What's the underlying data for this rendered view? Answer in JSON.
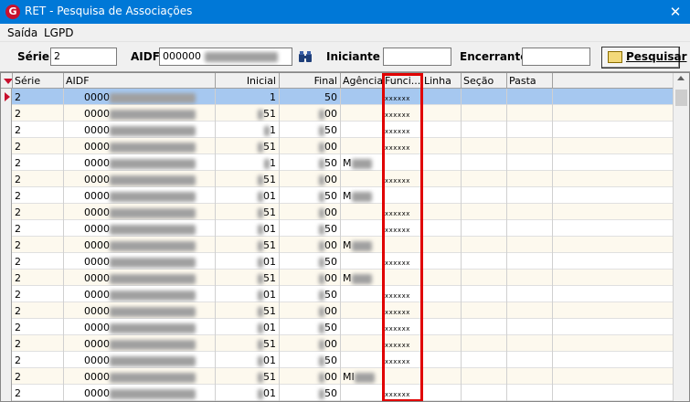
{
  "window": {
    "app_icon": "G",
    "title": "RET - Pesquisa de Associações",
    "close_label": "✕"
  },
  "menu": {
    "items": [
      "Saída",
      "LGPD"
    ]
  },
  "toolbar": {
    "serie_label": "Série",
    "serie_value": "2",
    "aidf_label": "AIDF",
    "aidf_value": "000000",
    "aidf_lookup_icon": "binoculars-icon",
    "iniciante_label": "Iniciante",
    "iniciante_value": "",
    "encerrante_label": "Encerrante",
    "encerrante_value": "",
    "search_button_label": "Pesquisar",
    "search_button_icon": "search-icon"
  },
  "grid": {
    "columns": [
      "Série",
      "AIDF",
      "Inicial",
      "Final",
      "Agência",
      "Funci...",
      "Linha",
      "Seção",
      "Pasta"
    ],
    "highlight_color": "#e00000",
    "selected_row_color": "#a6c8f0",
    "rows": [
      {
        "serie": "2",
        "aidf": "0000",
        "inicial": "1",
        "final": "50",
        "agencia": "",
        "funci": "xxxxxx"
      },
      {
        "serie": "2",
        "aidf": "0000",
        "inicial": "51",
        "final": "00",
        "agencia": "",
        "funci": "xxxxxx"
      },
      {
        "serie": "2",
        "aidf": "0000",
        "inicial": "1",
        "final": "50",
        "agencia": "",
        "funci": "xxxxxx"
      },
      {
        "serie": "2",
        "aidf": "0000",
        "inicial": "51",
        "final": "00",
        "agencia": "",
        "funci": "xxxxxx"
      },
      {
        "serie": "2",
        "aidf": "0000",
        "inicial": "1",
        "final": "50",
        "agencia": "M",
        "funci": ""
      },
      {
        "serie": "2",
        "aidf": "0000",
        "inicial": "51",
        "final": "00",
        "agencia": "",
        "funci": "xxxxxx"
      },
      {
        "serie": "2",
        "aidf": "0000",
        "inicial": "01",
        "final": "50",
        "agencia": "M",
        "funci": ""
      },
      {
        "serie": "2",
        "aidf": "0000",
        "inicial": "51",
        "final": "00",
        "agencia": "",
        "funci": "xxxxxx"
      },
      {
        "serie": "2",
        "aidf": "0000",
        "inicial": "01",
        "final": "50",
        "agencia": "",
        "funci": "xxxxxx"
      },
      {
        "serie": "2",
        "aidf": "0000",
        "inicial": "51",
        "final": "00",
        "agencia": "M",
        "funci": ""
      },
      {
        "serie": "2",
        "aidf": "0000",
        "inicial": "01",
        "final": "50",
        "agencia": "",
        "funci": "xxxxxx"
      },
      {
        "serie": "2",
        "aidf": "0000",
        "inicial": "51",
        "final": "00",
        "agencia": "M",
        "funci": ""
      },
      {
        "serie": "2",
        "aidf": "0000",
        "inicial": "01",
        "final": "50",
        "agencia": "",
        "funci": "xxxxxx"
      },
      {
        "serie": "2",
        "aidf": "0000",
        "inicial": "51",
        "final": "00",
        "agencia": "",
        "funci": "xxxxxx"
      },
      {
        "serie": "2",
        "aidf": "0000",
        "inicial": "01",
        "final": "50",
        "agencia": "",
        "funci": "xxxxxx"
      },
      {
        "serie": "2",
        "aidf": "0000",
        "inicial": "51",
        "final": "00",
        "agencia": "",
        "funci": "xxxxxx"
      },
      {
        "serie": "2",
        "aidf": "0000",
        "inicial": "01",
        "final": "50",
        "agencia": "",
        "funci": "xxxxxx"
      },
      {
        "serie": "2",
        "aidf": "0000",
        "inicial": "51",
        "final": "00",
        "agencia": "MI",
        "funci": ""
      },
      {
        "serie": "2",
        "aidf": "0000",
        "inicial": "01",
        "final": "50",
        "agencia": "",
        "funci": "xxxxxx"
      }
    ]
  }
}
